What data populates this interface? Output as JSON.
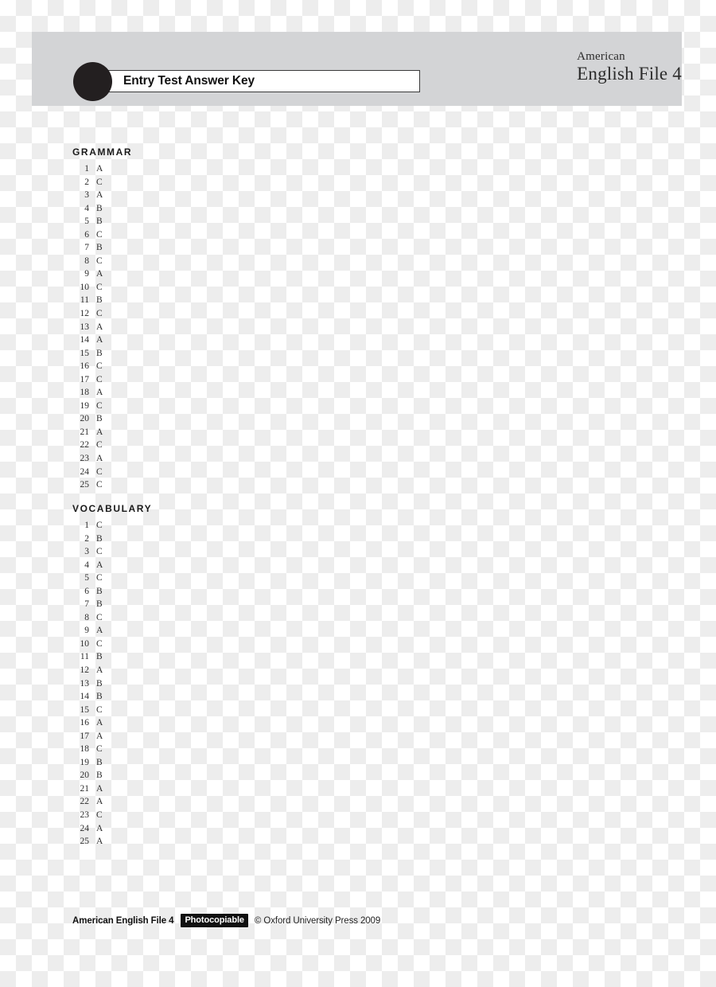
{
  "header": {
    "title": "Entry Test Answer Key",
    "brand_line1": "American",
    "brand_line2": "English File 4",
    "band_color": "#d3d4d6",
    "circle_color": "#231f20"
  },
  "sections": [
    {
      "title": "GRAMMAR",
      "answers": [
        {
          "number": "1",
          "answer": "A"
        },
        {
          "number": "2",
          "answer": "C"
        },
        {
          "number": "3",
          "answer": "A"
        },
        {
          "number": "4",
          "answer": "B"
        },
        {
          "number": "5",
          "answer": "B"
        },
        {
          "number": "6",
          "answer": "C"
        },
        {
          "number": "7",
          "answer": "B"
        },
        {
          "number": "8",
          "answer": "C"
        },
        {
          "number": "9",
          "answer": "A"
        },
        {
          "number": "10",
          "answer": "C"
        },
        {
          "number": "11",
          "answer": "B"
        },
        {
          "number": "12",
          "answer": "C"
        },
        {
          "number": "13",
          "answer": "A"
        },
        {
          "number": "14",
          "answer": "A"
        },
        {
          "number": "15",
          "answer": "B"
        },
        {
          "number": "16",
          "answer": "C"
        },
        {
          "number": "17",
          "answer": "C"
        },
        {
          "number": "18",
          "answer": "A"
        },
        {
          "number": "19",
          "answer": "C"
        },
        {
          "number": "20",
          "answer": "B"
        },
        {
          "number": "21",
          "answer": "A"
        },
        {
          "number": "22",
          "answer": "C"
        },
        {
          "number": "23",
          "answer": "A"
        },
        {
          "number": "24",
          "answer": "C"
        },
        {
          "number": "25",
          "answer": "C"
        }
      ]
    },
    {
      "title": "VOCABULARY",
      "answers": [
        {
          "number": "1",
          "answer": "C"
        },
        {
          "number": "2",
          "answer": "B"
        },
        {
          "number": "3",
          "answer": "C"
        },
        {
          "number": "4",
          "answer": "A"
        },
        {
          "number": "5",
          "answer": "C"
        },
        {
          "number": "6",
          "answer": "B"
        },
        {
          "number": "7",
          "answer": "B"
        },
        {
          "number": "8",
          "answer": "C"
        },
        {
          "number": "9",
          "answer": "A"
        },
        {
          "number": "10",
          "answer": "C"
        },
        {
          "number": "11",
          "answer": "B"
        },
        {
          "number": "12",
          "answer": "A"
        },
        {
          "number": "13",
          "answer": "B"
        },
        {
          "number": "14",
          "answer": "B"
        },
        {
          "number": "15",
          "answer": "C"
        },
        {
          "number": "16",
          "answer": "A"
        },
        {
          "number": "17",
          "answer": "A"
        },
        {
          "number": "18",
          "answer": "C"
        },
        {
          "number": "19",
          "answer": "B"
        },
        {
          "number": "20",
          "answer": "B"
        },
        {
          "number": "21",
          "answer": "A"
        },
        {
          "number": "22",
          "answer": "A"
        },
        {
          "number": "23",
          "answer": "C"
        },
        {
          "number": "24",
          "answer": "A"
        },
        {
          "number": "25",
          "answer": "A"
        }
      ]
    }
  ],
  "footer": {
    "brand": "American English File 4",
    "badge": "Photocopiable",
    "copyright": "© Oxford University Press 2009"
  }
}
